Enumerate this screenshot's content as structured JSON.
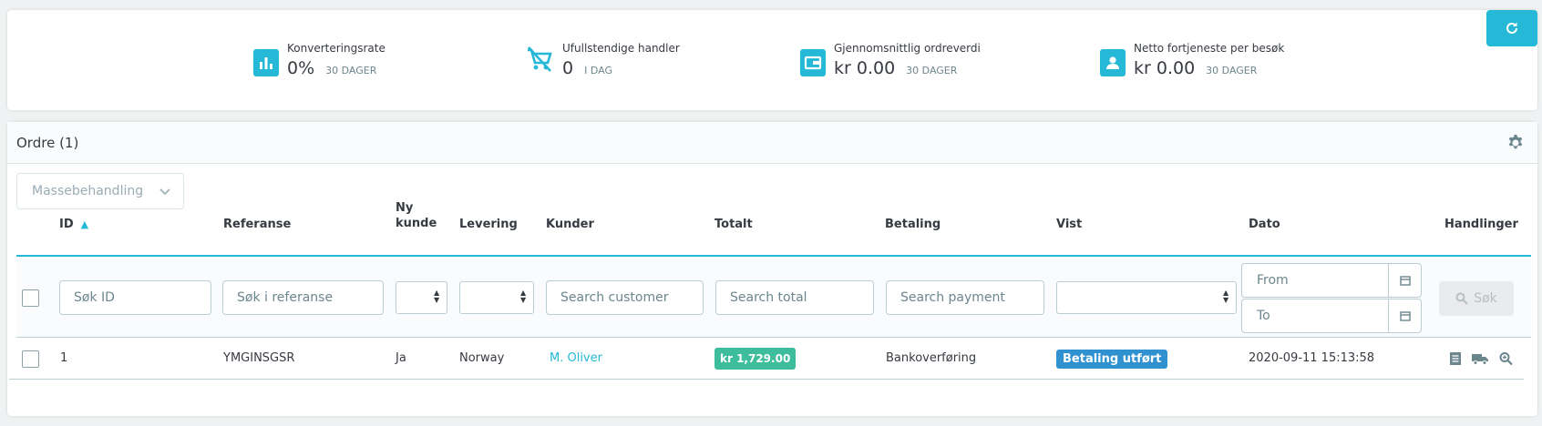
{
  "kpis": [
    {
      "icon": "bar-chart-icon",
      "title": "Konverteringsrate",
      "value": "0%",
      "period": "30 DAGER"
    },
    {
      "icon": "cart-off-icon",
      "title": "Ufullstendige handler",
      "value": "0",
      "period": "I DAG"
    },
    {
      "icon": "wallet-icon",
      "title": "Gjennomsnittlig ordreverdi",
      "value": "kr 0.00",
      "period": "30 DAGER"
    },
    {
      "icon": "user-icon",
      "title": "Netto fortjeneste per besøk",
      "value": "kr 0.00",
      "period": "30 DAGER"
    }
  ],
  "refresh": {
    "icon": "refresh-icon"
  },
  "orders": {
    "title": "Ordre (1)",
    "bulk_label": "Massebehandling",
    "columns": {
      "id": "ID",
      "reference": "Referanse",
      "new_customer_1": "Ny",
      "new_customer_2": "kunde",
      "delivery": "Levering",
      "customer": "Kunder",
      "total": "Totalt",
      "payment": "Betaling",
      "status": "Vist",
      "date": "Dato",
      "actions": "Handlinger"
    },
    "filters": {
      "id_placeholder": "Søk ID",
      "reference_placeholder": "Søk i referanse",
      "customer_placeholder": "Search customer",
      "total_placeholder": "Search total",
      "payment_placeholder": "Search payment",
      "date_from": "From",
      "date_to": "To",
      "search_label": "Søk"
    },
    "rows": [
      {
        "id": "1",
        "reference": "YMGINSGSR",
        "new_customer": "Ja",
        "delivery": "Norway",
        "customer": "M. Oliver",
        "total": "kr 1,729.00",
        "payment": "Bankoverføring",
        "status": "Betaling utført",
        "date": "2020-09-11 15:13:58"
      }
    ]
  },
  "colors": {
    "accent": "#25b9d7",
    "total_badge": "#3ebd9d",
    "status_badge": "#3091d1"
  }
}
